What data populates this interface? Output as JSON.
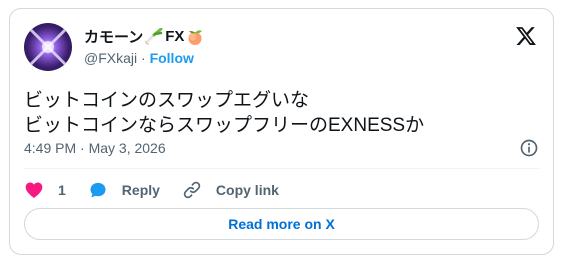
{
  "author": {
    "display_name": "カモーン",
    "name_emoji_1": "leek-emoji",
    "name_suffix": "FX",
    "name_emoji_2": "peach-emoji",
    "handle": "@FXkaji",
    "separator": "·",
    "follow_label": "Follow"
  },
  "tweet": {
    "lines": [
      "ビットコインのスワップエグいな",
      "ビットコインならスワップフリーのEXNESSか"
    ],
    "timestamp": "4:49 PM · May 3, 2026"
  },
  "actions": {
    "like_count": "1",
    "reply_label": "Reply",
    "copy_link_label": "Copy link"
  },
  "read_more_label": "Read more on X",
  "colors": {
    "accent": "#1d9bf0",
    "like": "#f91880",
    "text": "#0f1419",
    "secondary_text": "#536471",
    "border": "#cfd9de",
    "read_more": "#006fd6"
  },
  "icons": [
    "x-logo-icon",
    "info-icon",
    "heart-icon",
    "reply-bubble-icon",
    "link-icon"
  ]
}
